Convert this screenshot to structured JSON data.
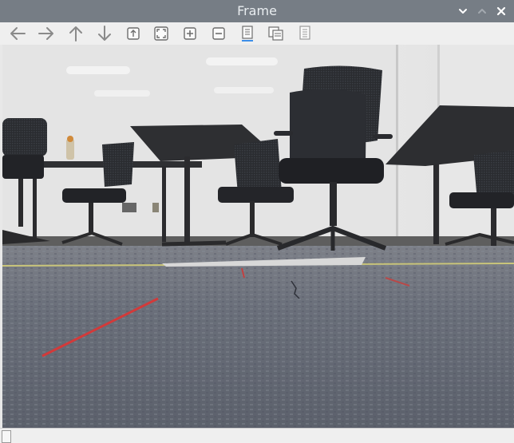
{
  "window": {
    "title": "Frame",
    "controls": [
      "chevron-down-icon",
      "chevron-up-icon",
      "close-icon"
    ]
  },
  "toolbar": {
    "buttons": [
      {
        "icon": "arrow-left-icon"
      },
      {
        "icon": "arrow-right-icon"
      },
      {
        "icon": "arrow-up-icon"
      },
      {
        "icon": "arrow-down-icon"
      },
      {
        "icon": "fit-page-icon"
      },
      {
        "icon": "zoom-fit-icon"
      },
      {
        "icon": "zoom-in-icon"
      },
      {
        "icon": "zoom-out-icon"
      },
      {
        "icon": "single-page-icon"
      },
      {
        "icon": "multi-page-icon"
      },
      {
        "icon": "page-list-icon"
      }
    ]
  },
  "colors": {
    "titlebar": "#767d85",
    "title_text": "#e9edf0",
    "icon_gray": "#8a8a8a",
    "accent_blue": "#3d8ee8"
  },
  "image": {
    "description_icon": "camera-frame-image"
  }
}
